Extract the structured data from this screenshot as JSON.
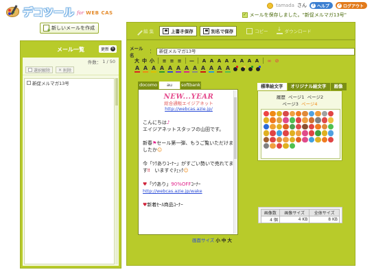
{
  "header": {
    "logo_text": "デコツール",
    "logo_for": "for",
    "logo_brand": "WEB CAS",
    "user_name": "tamada",
    "user_suffix": "さん",
    "help_label": "ヘルプ",
    "logout_label": "ログアウト",
    "saved_message": "メールを保存しました。\"新促メルマガ13号\""
  },
  "sidebar": {
    "new_mail_button": "新しいメールを作成",
    "panel_title": "メール一覧",
    "refresh_label": "更新",
    "count_label": "件数：",
    "count_value": "1 / 50",
    "select_clear_label": "選択解除",
    "delete_label": "削除",
    "mails": [
      {
        "title": "新促メルマガ13号",
        "checked": false
      }
    ]
  },
  "toolbar": {
    "edit_label": "編 集",
    "overwrite_label": "上書き保存",
    "save_as_label": "別名で保存",
    "copy_label": "コピー",
    "download_label": "ダウンロード"
  },
  "editor": {
    "subject_label": "メール名",
    "subject_value": "新促メルマガ13号",
    "format_row1": [
      "大",
      "中",
      "小",
      "≡",
      "≡",
      "≡",
      "—",
      "A",
      "A",
      "A",
      "A",
      "A",
      "A",
      "A",
      "A"
    ],
    "format_colors_row1": [
      "#e02020",
      "#f08a14",
      "#e0c000",
      "#2a9a2a",
      "#2a4bd7",
      "#8a2ad7",
      "#e0208a",
      "#333333"
    ],
    "format_colors_row2": [
      "#e02020",
      "#f08a14",
      "#e0c000",
      "#2a9a2a",
      "#2a4bd7",
      "#8a2ad7",
      "#e0208a",
      "#888888",
      "#d01010",
      "#20a0e0",
      "#a05020",
      "#50c050",
      "#222222",
      "#222222",
      "#222222",
      "#222222"
    ]
  },
  "preview": {
    "tabs": [
      "docomo",
      "au",
      "softbank"
    ],
    "active_tab": "au",
    "banner_new": "NEW...YEAR",
    "banner_org": "総合通販エイジアネット",
    "banner_url": "http://webcas.azie.jp/",
    "lines": [
      "こんにちは",
      "エイジアネットスタッフの山田です。",
      "新春",
      "セール第一弾、もうご覧いただけましたか",
      "今「ﾂｳありｺｰﾅｰ」がすごい勢いで売れてます",
      "いますぐﾁｪｯｸ",
      "「ﾂｳあり」",
      "90%OFF",
      "ｺｰﾅｰ",
      "http://webcas.azie.jp/wake",
      "新着ｾｰﾙ商品ｺｰﾅｰ"
    ],
    "image_size_label": "画面サイズ",
    "image_sizes": [
      "小",
      "中",
      "大"
    ]
  },
  "decoration": {
    "tabs": [
      "標準絵文字",
      "オリジナル絵文字",
      "画像"
    ],
    "active_tab": "標準絵文字",
    "history_label": "履歴",
    "pages": [
      "ページ1",
      "ページ2",
      "ページ3",
      "ページ4"
    ],
    "current_page": "ページ4",
    "emoji_colors": [
      "#ee4444",
      "#f08a14",
      "#e0b020",
      "#d84a4a",
      "#f0a040",
      "#f07a20",
      "#e08a3a",
      "#50a0e0",
      "#f09a3a",
      "#a0a0a0",
      "#e04444",
      "#e0b020",
      "#f07a20",
      "#e0a040",
      "#e04a8a",
      "#50c050",
      "#e04444",
      "#f0a040",
      "#d07030",
      "#808080",
      "#e04a4a",
      "#f0c040",
      "#2a6ad7",
      "#f0a030",
      "#e0b020",
      "#e06020",
      "#50a050",
      "#e04a4a",
      "#8a5030",
      "#e04444",
      "#f07a20",
      "#e08a3a",
      "#50c050",
      "#e0b020",
      "#e04444",
      "#40a0e0",
      "#e04444",
      "#e0b020",
      "#f0a040",
      "#e04a8a",
      "#e04444",
      "#40a040",
      "#e0b020",
      "#50a0e0",
      "#a06030",
      "#e04444",
      "#e08a3a",
      "#f0a040",
      "#e0b020",
      "#e06020",
      "#e04a8a",
      "#40a0e0",
      "#e0b020",
      "#f07a20",
      "#e04444",
      "#808080",
      "#f0a040",
      "#e04444",
      "#e0b020",
      "#50c050"
    ],
    "stats_headers": [
      "画像数",
      "画像サイズ",
      "全体サイズ"
    ],
    "stats_values": [
      "4 個",
      "4 KB",
      "8 KB"
    ]
  }
}
